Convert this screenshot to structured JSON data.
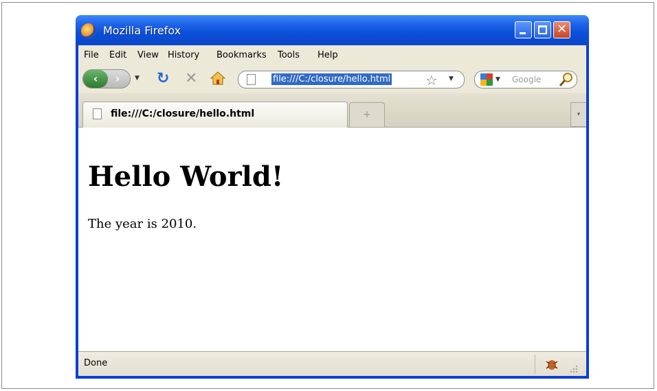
{
  "window": {
    "title": "Mozilla Firefox",
    "controls": {
      "minimize": "",
      "maximize": "",
      "close": "✕"
    }
  },
  "menubar": {
    "items": [
      "File",
      "Edit",
      "View",
      "History",
      "Bookmarks",
      "Tools",
      "Help"
    ]
  },
  "navbar": {
    "back_icon": "back-arrow-icon",
    "forward_icon": "forward-arrow-icon",
    "reload_icon": "reload-icon",
    "stop_icon": "stop-icon",
    "home_icon": "home-icon",
    "url": "file:///C:/closure/hello.html",
    "search_placeholder": "Google"
  },
  "tabs": {
    "active_label": "file:///C:/closure/hello.html",
    "new_tab_glyph": "+",
    "list_glyph": "▾"
  },
  "page": {
    "heading": "Hello World!",
    "paragraph": "The year is 2010."
  },
  "statusbar": {
    "text": "Done"
  },
  "colors": {
    "titlebar": "#0a50d8",
    "chrome": "#ece9d8",
    "url_highlight": "#316ac5"
  }
}
